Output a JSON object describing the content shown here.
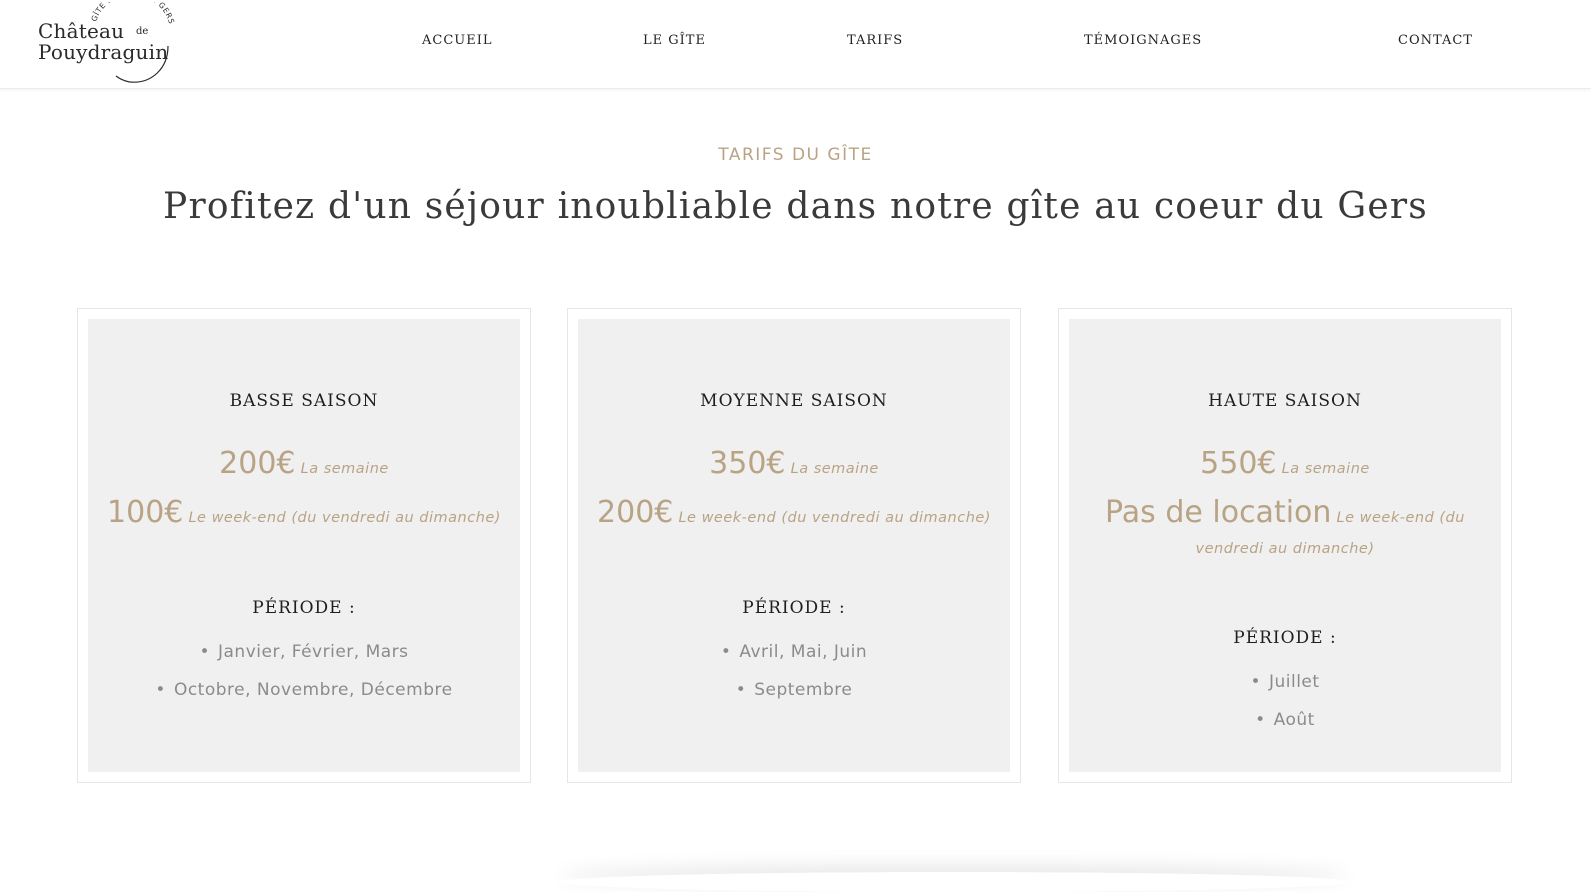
{
  "logo": {
    "arc_text": "GÎTE DE CHARME GERS",
    "line1": "Château",
    "de": "de",
    "line2": "Pouydraguin"
  },
  "nav": {
    "items": [
      {
        "label": "ACCUEIL"
      },
      {
        "label": "LE GÎTE"
      },
      {
        "label": "TARIFS"
      },
      {
        "label": "TÉMOIGNAGES"
      },
      {
        "label": "CONTACT"
      }
    ]
  },
  "section": {
    "eyebrow": "TARIFS DU GÎTE",
    "headline": "Profitez d'un séjour inoubliable dans notre gîte au coeur du Gers"
  },
  "cards": [
    {
      "season": "BASSE SAISON",
      "week_price": "200€",
      "week_unit": "La semaine",
      "weekend_price": "100€",
      "weekend_unit": "Le week-end (du vendredi au dimanche)",
      "periode_label": "PÉRIODE :",
      "months": [
        "Janvier, Février, Mars",
        "Octobre, Novembre, Décembre"
      ]
    },
    {
      "season": "MOYENNE SAISON",
      "week_price": "350€",
      "week_unit": "La semaine",
      "weekend_price": "200€",
      "weekend_unit": "Le week-end (du vendredi au dimanche)",
      "periode_label": "PÉRIODE :",
      "months": [
        "Avril, Mai, Juin",
        "Septembre"
      ]
    },
    {
      "season": "HAUTE SAISON",
      "week_price": "550€",
      "week_unit": "La semaine",
      "weekend_price": "Pas de location",
      "weekend_unit": "Le week-end (du vendredi au dimanche)",
      "periode_label": "PÉRIODE :",
      "months": [
        "Juillet",
        "Août"
      ]
    }
  ],
  "colors": {
    "accent_gold": "#b9a385",
    "card_bg": "#f0f0f0",
    "text_dark": "#1e1e1e",
    "text_muted": "#8b8b8b"
  }
}
